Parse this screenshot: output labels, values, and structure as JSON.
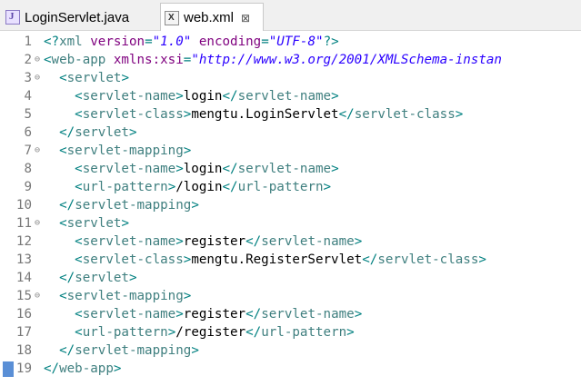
{
  "tabs": [
    {
      "label": "LoginServlet.java",
      "icon": "java-file-icon",
      "active": false
    },
    {
      "label": "web.xml",
      "icon": "xml-file-icon",
      "active": true,
      "close_glyph": "⊠"
    }
  ],
  "fold_glyph": "⊖",
  "lines": [
    {
      "n": "1",
      "fold": false,
      "indent": "",
      "tokens": [
        [
          "punct",
          "<?"
        ],
        [
          "tag",
          "xml"
        ],
        [
          "text",
          " "
        ],
        [
          "attr",
          "version"
        ],
        [
          "punct",
          "="
        ],
        [
          "val",
          "\"1.0\""
        ],
        [
          "text",
          " "
        ],
        [
          "attr",
          "encoding"
        ],
        [
          "punct",
          "="
        ],
        [
          "val",
          "\"UTF-8\""
        ],
        [
          "punct",
          "?>"
        ]
      ]
    },
    {
      "n": "2",
      "fold": true,
      "indent": "",
      "tokens": [
        [
          "punct",
          "<"
        ],
        [
          "tag",
          "web-app"
        ],
        [
          "text",
          " "
        ],
        [
          "attr",
          "xmlns:xsi"
        ],
        [
          "punct",
          "="
        ],
        [
          "val",
          "\"http://www.w3.org/2001/XMLSchema-instan"
        ]
      ]
    },
    {
      "n": "3",
      "fold": true,
      "indent": "  ",
      "tokens": [
        [
          "punct",
          "<"
        ],
        [
          "tag",
          "servlet"
        ],
        [
          "punct",
          ">"
        ]
      ]
    },
    {
      "n": "4",
      "fold": false,
      "indent": "    ",
      "tokens": [
        [
          "punct",
          "<"
        ],
        [
          "tag",
          "servlet-name"
        ],
        [
          "punct",
          ">"
        ],
        [
          "text",
          "login"
        ],
        [
          "punct",
          "</"
        ],
        [
          "tag",
          "servlet-name"
        ],
        [
          "punct",
          ">"
        ]
      ]
    },
    {
      "n": "5",
      "fold": false,
      "indent": "    ",
      "tokens": [
        [
          "punct",
          "<"
        ],
        [
          "tag",
          "servlet-class"
        ],
        [
          "punct",
          ">"
        ],
        [
          "text",
          "mengtu.LoginServlet"
        ],
        [
          "punct",
          "</"
        ],
        [
          "tag",
          "servlet-class"
        ],
        [
          "punct",
          ">"
        ]
      ]
    },
    {
      "n": "6",
      "fold": false,
      "indent": "  ",
      "tokens": [
        [
          "punct",
          "</"
        ],
        [
          "tag",
          "servlet"
        ],
        [
          "punct",
          ">"
        ]
      ]
    },
    {
      "n": "7",
      "fold": true,
      "indent": "  ",
      "tokens": [
        [
          "punct",
          "<"
        ],
        [
          "tag",
          "servlet-mapping"
        ],
        [
          "punct",
          ">"
        ]
      ]
    },
    {
      "n": "8",
      "fold": false,
      "indent": "    ",
      "tokens": [
        [
          "punct",
          "<"
        ],
        [
          "tag",
          "servlet-name"
        ],
        [
          "punct",
          ">"
        ],
        [
          "text",
          "login"
        ],
        [
          "punct",
          "</"
        ],
        [
          "tag",
          "servlet-name"
        ],
        [
          "punct",
          ">"
        ]
      ]
    },
    {
      "n": "9",
      "fold": false,
      "indent": "    ",
      "tokens": [
        [
          "punct",
          "<"
        ],
        [
          "tag",
          "url-pattern"
        ],
        [
          "punct",
          ">"
        ],
        [
          "text",
          "/login"
        ],
        [
          "punct",
          "</"
        ],
        [
          "tag",
          "url-pattern"
        ],
        [
          "punct",
          ">"
        ]
      ]
    },
    {
      "n": "10",
      "fold": false,
      "indent": "  ",
      "tokens": [
        [
          "punct",
          "</"
        ],
        [
          "tag",
          "servlet-mapping"
        ],
        [
          "punct",
          ">"
        ]
      ]
    },
    {
      "n": "11",
      "fold": true,
      "indent": "  ",
      "tokens": [
        [
          "punct",
          "<"
        ],
        [
          "tag",
          "servlet"
        ],
        [
          "punct",
          ">"
        ]
      ]
    },
    {
      "n": "12",
      "fold": false,
      "indent": "    ",
      "tokens": [
        [
          "punct",
          "<"
        ],
        [
          "tag",
          "servlet-name"
        ],
        [
          "punct",
          ">"
        ],
        [
          "text",
          "register"
        ],
        [
          "punct",
          "</"
        ],
        [
          "tag",
          "servlet-name"
        ],
        [
          "punct",
          ">"
        ]
      ]
    },
    {
      "n": "13",
      "fold": false,
      "indent": "    ",
      "tokens": [
        [
          "punct",
          "<"
        ],
        [
          "tag",
          "servlet-class"
        ],
        [
          "punct",
          ">"
        ],
        [
          "text",
          "mengtu.RegisterServlet"
        ],
        [
          "punct",
          "</"
        ],
        [
          "tag",
          "servlet-class"
        ],
        [
          "punct",
          ">"
        ]
      ]
    },
    {
      "n": "14",
      "fold": false,
      "indent": "  ",
      "tokens": [
        [
          "punct",
          "</"
        ],
        [
          "tag",
          "servlet"
        ],
        [
          "punct",
          ">"
        ]
      ]
    },
    {
      "n": "15",
      "fold": true,
      "indent": "  ",
      "tokens": [
        [
          "punct",
          "<"
        ],
        [
          "tag",
          "servlet-mapping"
        ],
        [
          "punct",
          ">"
        ]
      ]
    },
    {
      "n": "16",
      "fold": false,
      "indent": "    ",
      "tokens": [
        [
          "punct",
          "<"
        ],
        [
          "tag",
          "servlet-name"
        ],
        [
          "punct",
          ">"
        ],
        [
          "text",
          "register"
        ],
        [
          "punct",
          "</"
        ],
        [
          "tag",
          "servlet-name"
        ],
        [
          "punct",
          ">"
        ]
      ]
    },
    {
      "n": "17",
      "fold": false,
      "indent": "    ",
      "tokens": [
        [
          "punct",
          "<"
        ],
        [
          "tag",
          "url-pattern"
        ],
        [
          "punct",
          ">"
        ],
        [
          "text",
          "/register"
        ],
        [
          "punct",
          "</"
        ],
        [
          "tag",
          "url-pattern"
        ],
        [
          "punct",
          ">"
        ]
      ]
    },
    {
      "n": "18",
      "fold": false,
      "indent": "  ",
      "tokens": [
        [
          "punct",
          "</"
        ],
        [
          "tag",
          "servlet-mapping"
        ],
        [
          "punct",
          ">"
        ]
      ]
    },
    {
      "n": "19",
      "fold": false,
      "indent": "",
      "current": true,
      "tokens": [
        [
          "punct",
          "</"
        ],
        [
          "tag",
          "web-app"
        ],
        [
          "punct",
          ">"
        ]
      ]
    }
  ],
  "colors": {
    "punct": "#008080",
    "tag": "#3f7f7f",
    "attr": "#7f007f",
    "value": "#2a00ff",
    "text": "#000000",
    "line_number": "#787878",
    "caret_marker": "#5a8fd6"
  }
}
